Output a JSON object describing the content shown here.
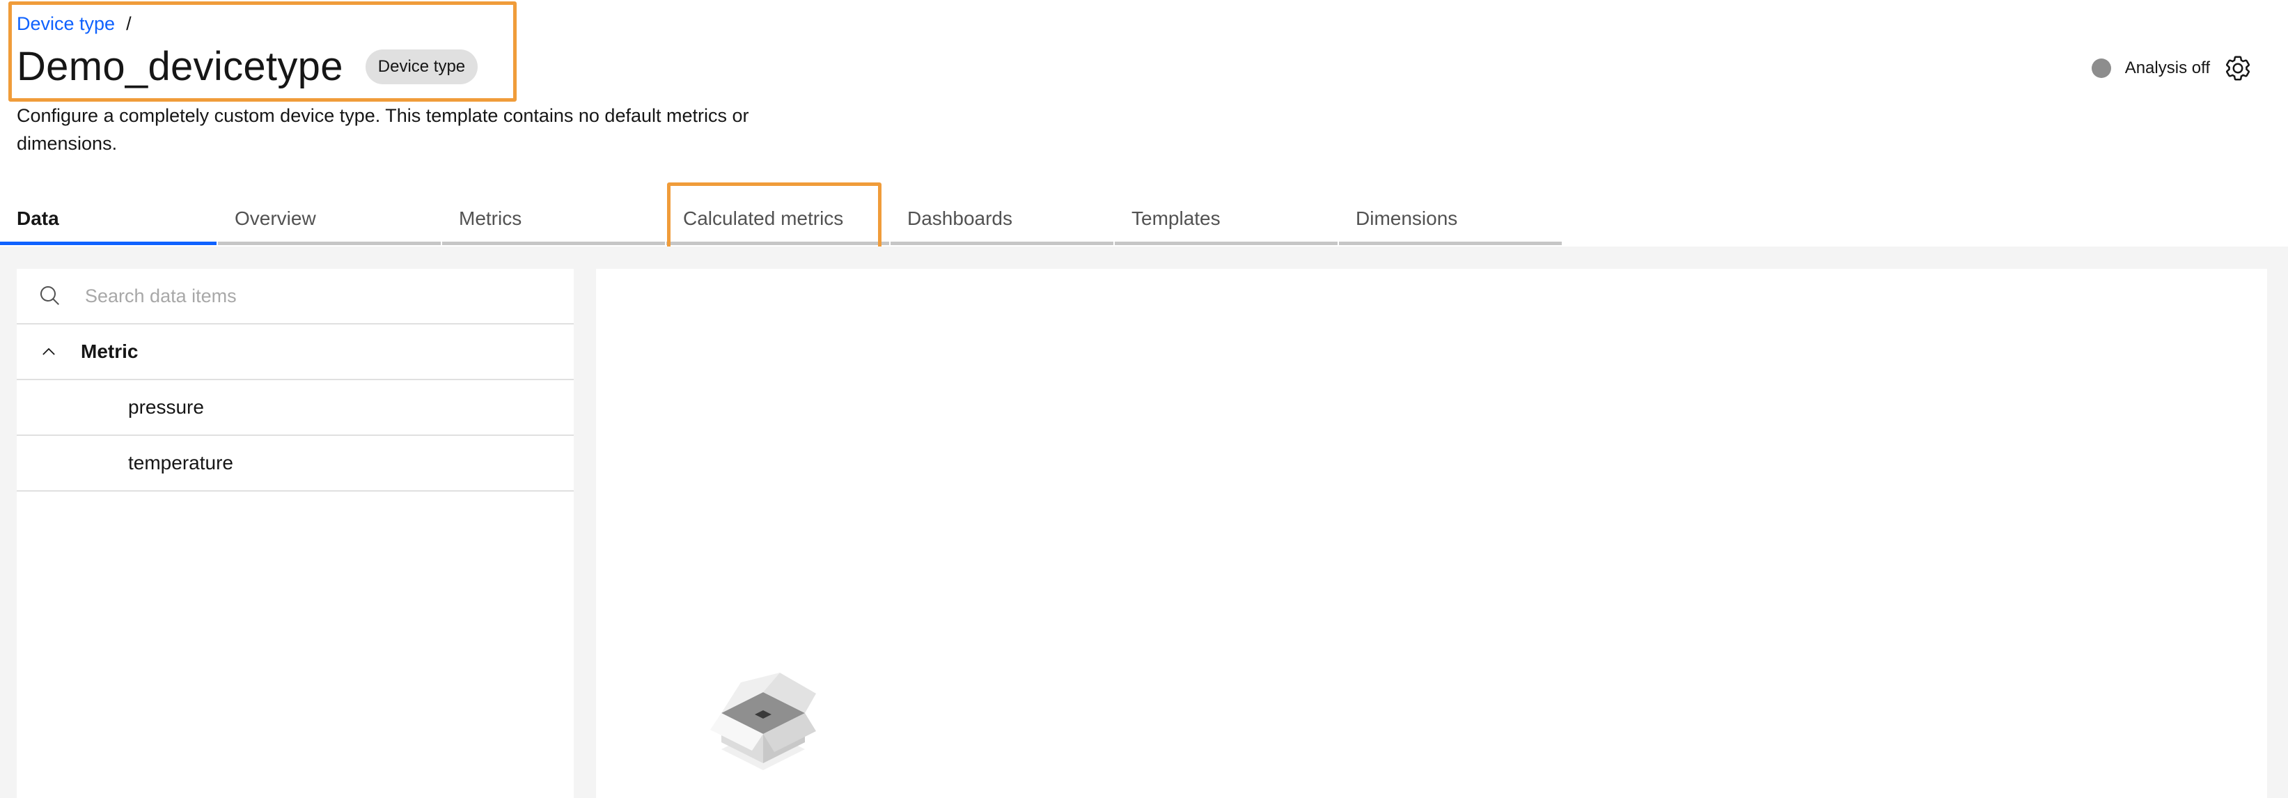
{
  "breadcrumb": {
    "link_label": "Device type",
    "separator": "/"
  },
  "header": {
    "title": "Demo_devicetype",
    "tag": "Device type",
    "description": "Configure a completely custom device type. This template contains no default metrics or dimensions."
  },
  "analysis": {
    "label": "Analysis off",
    "status_color": "#8d8d8d"
  },
  "tabs": [
    {
      "label": "Data",
      "active": true
    },
    {
      "label": "Overview",
      "active": false
    },
    {
      "label": "Metrics",
      "active": false
    },
    {
      "label": "Calculated metrics",
      "active": false
    },
    {
      "label": "Dashboards",
      "active": false
    },
    {
      "label": "Templates",
      "active": false
    },
    {
      "label": "Dimensions",
      "active": false
    }
  ],
  "sidebar": {
    "search_placeholder": "Search data items",
    "search_value": "",
    "group": {
      "label": "Metric",
      "expanded": true,
      "items": [
        {
          "label": "pressure"
        },
        {
          "label": "temperature"
        }
      ]
    }
  },
  "icons": {
    "search": "search-icon",
    "chevron": "chevron-up-icon",
    "settings": "gear-icon",
    "empty": "empty-box-icon"
  },
  "colors": {
    "accent": "#0f62fe",
    "highlight": "#f09c3a",
    "tag_bg": "#e0e0e0"
  }
}
